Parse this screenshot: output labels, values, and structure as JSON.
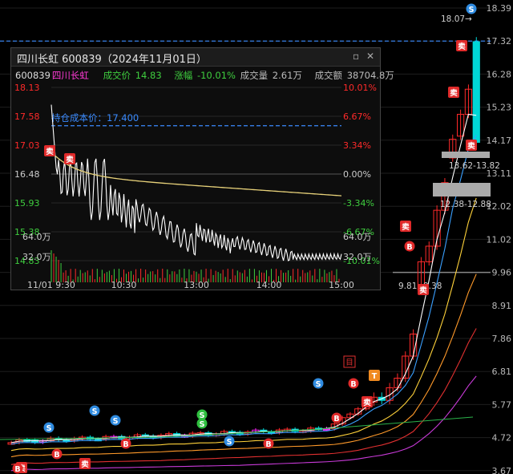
{
  "chart_data": [
    {
      "type": "candlestick",
      "y_axis_ticks": [
        "18.39",
        "17.32",
        "16.28",
        "15.23",
        "14.17",
        "13.11",
        "12.02",
        "11.02",
        "9.96",
        "8.91",
        "7.86",
        "6.81",
        "5.77",
        "4.72",
        "3.67"
      ],
      "current_price_line": 17.32,
      "ylim": [
        3.67,
        18.39
      ],
      "price_labels": [
        "18.07→",
        "13.62-13.82",
        "12.38-12.88",
        "9.81",
        "9.38"
      ],
      "signal_marks": [
        {
          "text": "S",
          "price": 18.3
        },
        {
          "text": "卖",
          "price": 16.7
        },
        {
          "text": "卖",
          "price": 15.25
        },
        {
          "text": "卖",
          "price": 14.1
        },
        {
          "text": "卖",
          "price": 11.6
        },
        {
          "text": "卖",
          "price": 9.6
        },
        {
          "text": "B",
          "price": 13.9
        },
        {
          "text": "卖",
          "price": 6.1
        },
        {
          "text": "B",
          "price": 5.7
        },
        {
          "text": "T",
          "price": 6.75
        },
        {
          "text": "S",
          "price": 6.5
        },
        {
          "text": "S",
          "price": 6.4
        },
        {
          "text": "S",
          "price": 5.6
        },
        {
          "text": "S",
          "price": 5.3
        },
        {
          "text": "S",
          "price": 5.15
        },
        {
          "text": "B",
          "price": 4.75
        },
        {
          "text": "S",
          "price": 5.2
        },
        {
          "text": "卖",
          "price": 5.4
        },
        {
          "text": "S",
          "price": 5.15
        },
        {
          "text": "B",
          "price": 4.6
        },
        {
          "text": "B",
          "price": 4.5
        },
        {
          "text": "卖",
          "price": 3.85
        },
        {
          "text": "B",
          "price": 3.75
        },
        {
          "text": "B",
          "price": 4.5
        }
      ],
      "marker_labels": [
        "目"
      ]
    },
    {
      "type": "line",
      "title": "四川长虹 600839（2024年11月01日）",
      "code": "600839",
      "name": "四川长虹",
      "fields": [
        {
          "label": "成交价",
          "value": "14.83"
        },
        {
          "label": "涨幅",
          "value": "-10.01%"
        },
        {
          "label": "成交量",
          "value": "2.61万"
        },
        {
          "label": "成交额",
          "value": "38704.8万"
        }
      ],
      "cost_label": "持仓成本价：17.400",
      "cost_price": 17.4,
      "prev_close": 16.48,
      "ylim": [
        14.83,
        18.13
      ],
      "left_ticks": [
        "18.13",
        "17.58",
        "17.03",
        "16.48",
        "15.93",
        "15.38",
        "14.83"
      ],
      "right_ticks": [
        "10.01%",
        "6.67%",
        "3.34%",
        "0.00%",
        "-3.34%",
        "-6.67%",
        "-10.01%"
      ],
      "volume_ticks": [
        "64.0万",
        "32.0万"
      ],
      "time_ticks": [
        "11/01 9:30",
        "10:30",
        "13:00",
        "14:00",
        "15:00"
      ],
      "trade_marks": [
        "卖",
        "卖"
      ]
    }
  ],
  "panel": {
    "restore_icon": "restore-window-icon",
    "close_icon": "close-icon"
  },
  "colors": {
    "up": "#ff2a2a",
    "down": "#00d7d7",
    "magenta": "#ff22ff",
    "price_line": "#ffffff",
    "avg_line": "#e8d27a",
    "cost_line": "#3a8bff",
    "axis_text": "#b8b8b8"
  }
}
